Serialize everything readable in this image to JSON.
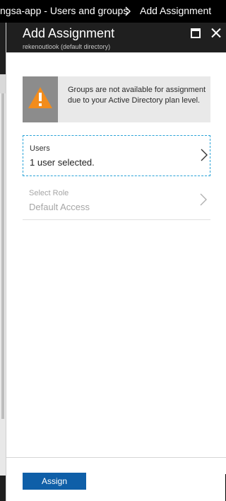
{
  "breadcrumb": {
    "items": [
      "ngsa-app - Users and groups",
      "Add Assignment"
    ]
  },
  "blade": {
    "title": "Add Assignment",
    "subtitle": "rekenoutlook (default directory)",
    "icons": {
      "maximize": "maximize-icon",
      "close": "close-icon"
    }
  },
  "warning": {
    "icon": "warning-icon",
    "text": "Groups are not available for assignment due to your Active Directory plan level."
  },
  "users_selector": {
    "label": "Users",
    "value": "1 user selected."
  },
  "role_selector": {
    "label": "Select Role",
    "value": "Default Access",
    "disabled": true
  },
  "footer": {
    "assign_label": "Assign"
  },
  "colors": {
    "header_bg": "#1f1f1f",
    "accent": "#0f5fa8",
    "selection_border": "#2aa3d8",
    "warning_orange": "#f28c1c"
  }
}
